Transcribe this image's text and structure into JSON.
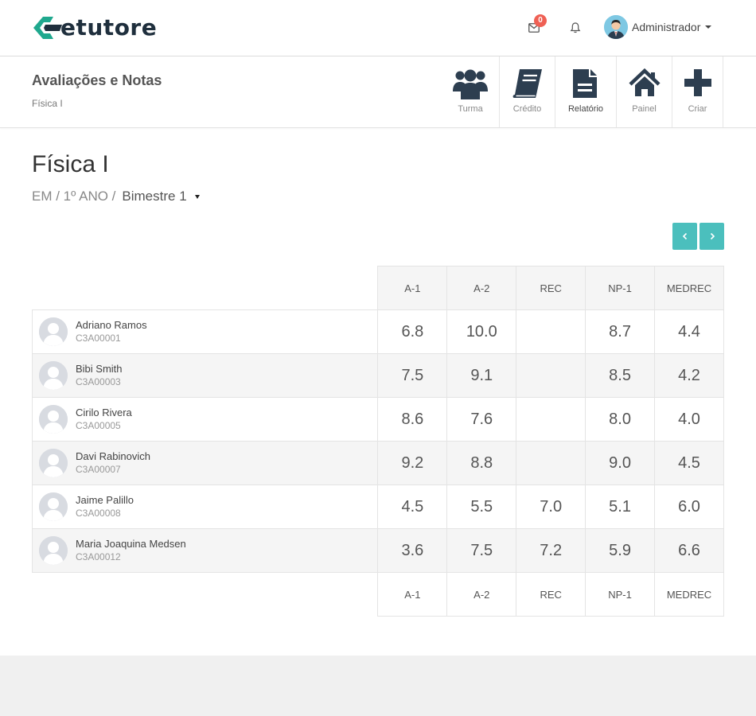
{
  "brand": {
    "logo_text": "etutore",
    "accent": "#1fa88e",
    "dark": "#1f2f3d"
  },
  "topbar": {
    "mail_count": "0",
    "user_name": "Administrador",
    "icons": [
      "envelope-icon",
      "bell-icon",
      "user-avatar"
    ]
  },
  "subheader": {
    "title": "Avaliações e Notas",
    "breadcrumb": "Física I",
    "toolbar": [
      {
        "label": "Turma",
        "icon": "users-icon"
      },
      {
        "label": "Crédito",
        "icon": "book-icon"
      },
      {
        "label": "Relatório",
        "icon": "document-icon"
      },
      {
        "label": "Painel",
        "icon": "home-icon"
      },
      {
        "label": "Criar",
        "icon": "plus-icon"
      }
    ]
  },
  "course": {
    "title": "Física I",
    "path": "EM / 1º ANO /",
    "bimestre": "Bimestre 1"
  },
  "pager": {
    "prev": "‹",
    "next": "›",
    "color": "#4bbfbd"
  },
  "table": {
    "columns": [
      "A-1",
      "A-2",
      "REC",
      "NP-1",
      "MEDREC"
    ],
    "rows": [
      {
        "name": "Adriano Ramos",
        "id": "C3A00001",
        "grades": [
          "6.8",
          "10.0",
          "",
          "8.7",
          "4.4"
        ]
      },
      {
        "name": "Bibi Smith",
        "id": "C3A00003",
        "grades": [
          "7.5",
          "9.1",
          "",
          "8.5",
          "4.2"
        ]
      },
      {
        "name": "Cirilo Rivera",
        "id": "C3A00005",
        "grades": [
          "8.6",
          "7.6",
          "",
          "8.0",
          "4.0"
        ]
      },
      {
        "name": "Davi Rabinovich",
        "id": "C3A00007",
        "grades": [
          "9.2",
          "8.8",
          "",
          "9.0",
          "4.5"
        ]
      },
      {
        "name": "Jaime Palillo",
        "id": "C3A00008",
        "grades": [
          "4.5",
          "5.5",
          "7.0",
          "5.1",
          "6.0"
        ]
      },
      {
        "name": "Maria Joaquina Medsen",
        "id": "C3A00012",
        "grades": [
          "3.6",
          "7.5",
          "7.2",
          "5.9",
          "6.6"
        ]
      }
    ]
  }
}
